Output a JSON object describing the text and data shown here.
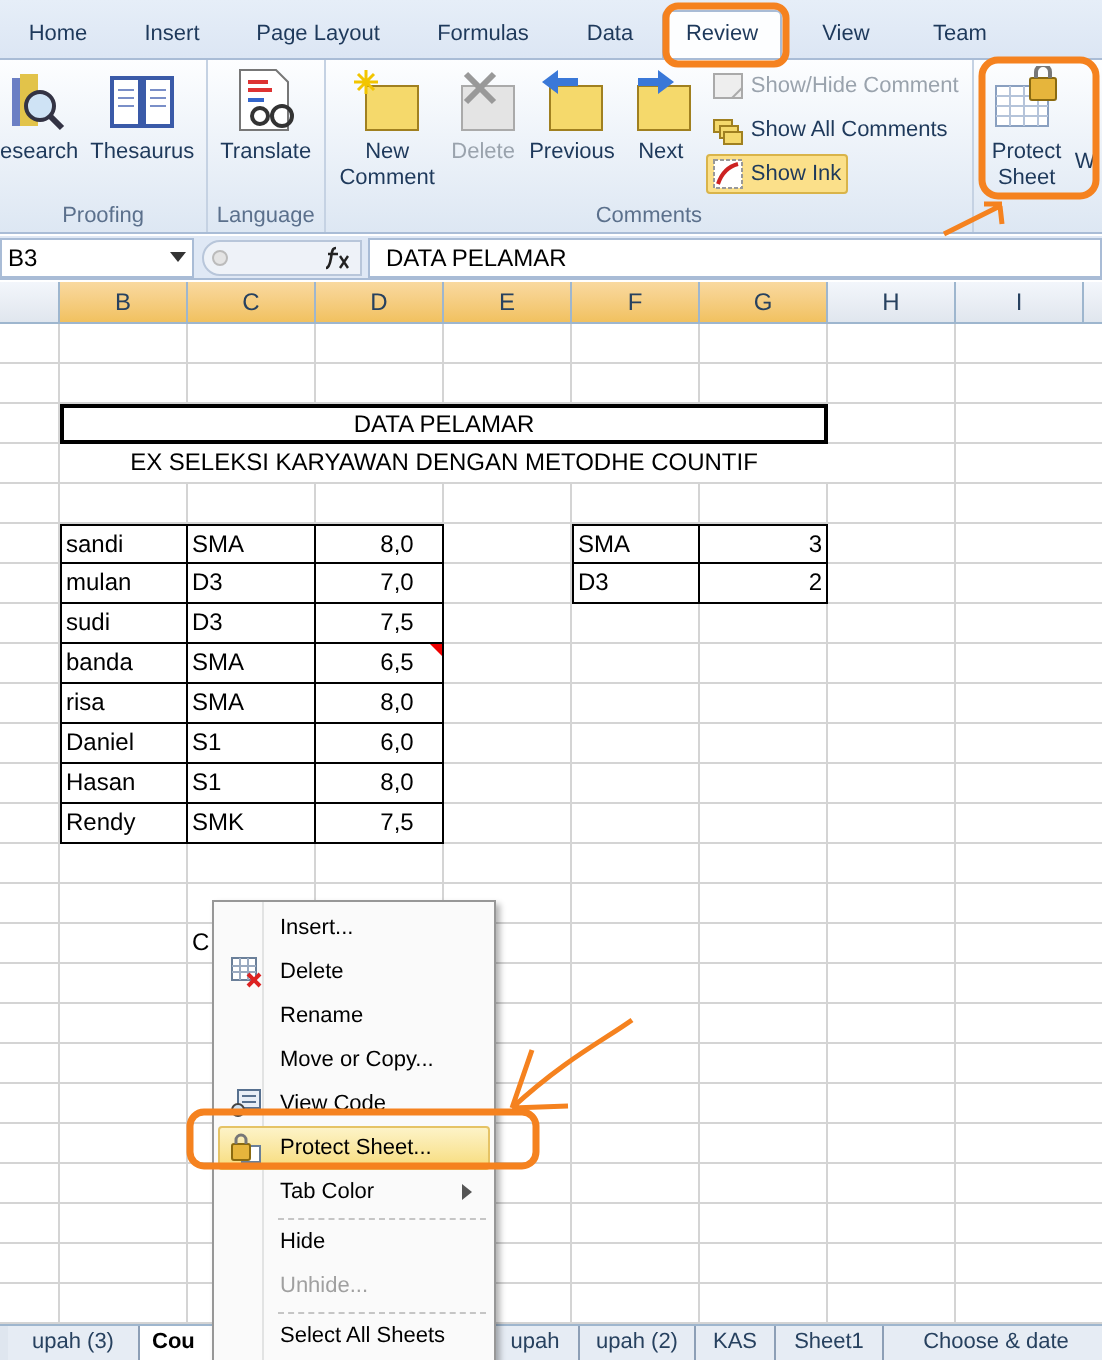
{
  "ribbon_tabs": [
    {
      "label": "Home",
      "selected": false
    },
    {
      "label": "Insert",
      "selected": false
    },
    {
      "label": "Page Layout",
      "selected": false
    },
    {
      "label": "Formulas",
      "selected": false
    },
    {
      "label": "Data",
      "selected": false
    },
    {
      "label": "Review",
      "selected": true
    },
    {
      "label": "View",
      "selected": false
    },
    {
      "label": "Team",
      "selected": false
    }
  ],
  "ribbon_groups": [
    {
      "label": "Proofing",
      "buttons": [
        {
          "label": "esearch",
          "disabled": false
        },
        {
          "label": "Thesaurus",
          "disabled": false
        }
      ]
    },
    {
      "label": "Language",
      "buttons": [
        {
          "label": "Translate",
          "disabled": false
        }
      ]
    },
    {
      "label": "Comments",
      "buttons": [
        {
          "label": "New Comment",
          "disabled": false
        },
        {
          "label": "Delete",
          "disabled": true
        },
        {
          "label": "Previous",
          "disabled": false
        },
        {
          "label": "Next",
          "disabled": false
        }
      ],
      "small_buttons": [
        {
          "label": "Show/Hide Comment",
          "disabled": true,
          "selected": false
        },
        {
          "label": "Show All Comments",
          "disabled": false,
          "selected": false
        },
        {
          "label": "Show Ink",
          "disabled": false,
          "selected": true
        }
      ]
    },
    {
      "buttons": [
        {
          "label": "Protect Sheet",
          "disabled": false
        }
      ],
      "cut_label": "W"
    }
  ],
  "formula_bar": {
    "name_box": "B3",
    "formula": "DATA PELAMAR"
  },
  "columns": [
    {
      "selected": false
    },
    {
      "label": "B",
      "selected": true
    },
    {
      "label": "C",
      "selected": true
    },
    {
      "label": "D",
      "selected": true
    },
    {
      "label": "E",
      "selected": true
    },
    {
      "label": "F",
      "selected": true
    },
    {
      "label": "G",
      "selected": true
    },
    {
      "label": "H",
      "selected": false
    },
    {
      "label": "I",
      "selected": false
    }
  ],
  "sheet": {
    "title": "DATA PELAMAR",
    "subtitle": "EX SELEKSI KARYAWAN DENGAN METODHE COUNTIF",
    "applicants": [
      {
        "name": "sandi",
        "education": "SMA",
        "score": "8,0",
        "has_comment": false
      },
      {
        "name": "mulan",
        "education": "D3",
        "score": "7,0",
        "has_comment": false
      },
      {
        "name": "sudi",
        "education": "D3",
        "score": "7,5",
        "has_comment": false
      },
      {
        "name": "banda",
        "education": "SMA",
        "score": "6,5",
        "has_comment": true
      },
      {
        "name": "risa",
        "education": "SMA",
        "score": "8,0",
        "has_comment": false
      },
      {
        "name": "Daniel",
        "education": "S1",
        "score": "6,0",
        "has_comment": false
      },
      {
        "name": "Hasan",
        "education": "S1",
        "score": "8,0",
        "has_comment": false
      },
      {
        "name": "Rendy",
        "education": "SMK",
        "score": "7,5",
        "has_comment": false
      }
    ],
    "summary": [
      {
        "label": "SMA",
        "count": "3"
      },
      {
        "label": "D3",
        "count": "2"
      }
    ],
    "covered_cell": "C"
  },
  "context_menu": [
    {
      "kind": "item",
      "label": "Insert...",
      "selected": false,
      "disabled": false
    },
    {
      "kind": "item",
      "label": "Delete",
      "selected": false,
      "disabled": false
    },
    {
      "kind": "item",
      "label": "Rename",
      "selected": false,
      "disabled": false
    },
    {
      "kind": "item",
      "label": "Move or Copy...",
      "selected": false,
      "disabled": false
    },
    {
      "kind": "item",
      "label": "View Code",
      "selected": false,
      "disabled": false
    },
    {
      "kind": "item",
      "label": "Protect Sheet...",
      "selected": true,
      "disabled": false
    },
    {
      "kind": "submenu",
      "label": "Tab Color",
      "selected": false,
      "disabled": false
    },
    {
      "kind": "separator"
    },
    {
      "kind": "item",
      "label": "Hide",
      "selected": false,
      "disabled": false
    },
    {
      "kind": "item",
      "label": "Unhide...",
      "selected": false,
      "disabled": true
    },
    {
      "kind": "separator"
    },
    {
      "kind": "item",
      "label": "Select All Sheets",
      "selected": false,
      "disabled": false
    }
  ],
  "sheet_tabs": [
    {
      "label": "upah (3)",
      "selected": false
    },
    {
      "label": "Cou",
      "selected": true
    },
    {
      "label": "upah",
      "selected": false
    },
    {
      "label": "upah (2)",
      "selected": false
    },
    {
      "label": "KAS",
      "selected": false
    },
    {
      "label": "Sheet1",
      "selected": false
    },
    {
      "label": "Choose & date",
      "selected": false
    }
  ]
}
